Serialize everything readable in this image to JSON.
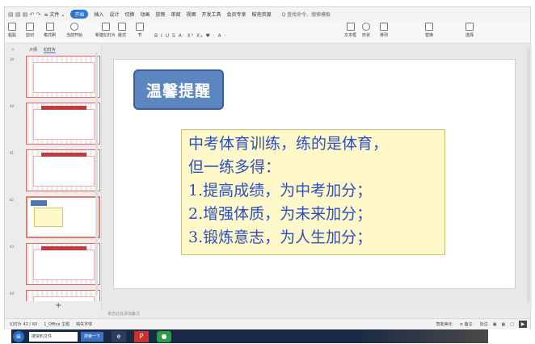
{
  "menubar": {
    "items": [
      "≡ 文件 ⌄",
      "开始",
      "插入",
      "设计",
      "切换",
      "动画",
      "放映",
      "审阅",
      "视图",
      "开发工具",
      "会员专享",
      "稻壳资源"
    ],
    "active_index": 1,
    "search": "Q 查找命令、搜索模板"
  },
  "ribbon": {
    "buttons": [
      "粘贴",
      "剪切",
      "格式刷",
      "当前开始",
      "新建幻灯片",
      "版式",
      "节"
    ],
    "right_buttons": [
      "文本框",
      "形状",
      "排列",
      "替换",
      "选择"
    ],
    "format_row": "B I U S A· X² X₂ ♥ · A ·"
  },
  "pane": {
    "tabs": [
      "大纲",
      "幻灯片"
    ],
    "active_tab": 1,
    "slide_numbers": [
      "39",
      "40",
      "41",
      "42",
      "43",
      "44"
    ],
    "current_index": 3,
    "add_label": "+"
  },
  "slide": {
    "title": "温馨提醒",
    "lines": [
      "中考体育训练，练的是体育，",
      "但一练多得：",
      "1.提高成绩，为中考加分；",
      "2.增强体质，为未来加分；",
      "3.锻炼意志，为人生加分；"
    ]
  },
  "notes": {
    "placeholder": "单击此处添加备注"
  },
  "status": {
    "slide_counter": "幻灯片 42 / 60",
    "theme": "1_Office 主题",
    "font_missing": "缺失字体",
    "right_items": [
      "智能美化 ·",
      "≡ 备注 ·",
      "批注"
    ]
  },
  "taskbar": {
    "search_text": "搜资料文件",
    "search_button": "搜索一下"
  },
  "colors": {
    "accent": "#2f74d0",
    "title_box": "#5b86bf",
    "text_box": "#fff8c8",
    "slide_text": "#2e4ec2"
  }
}
